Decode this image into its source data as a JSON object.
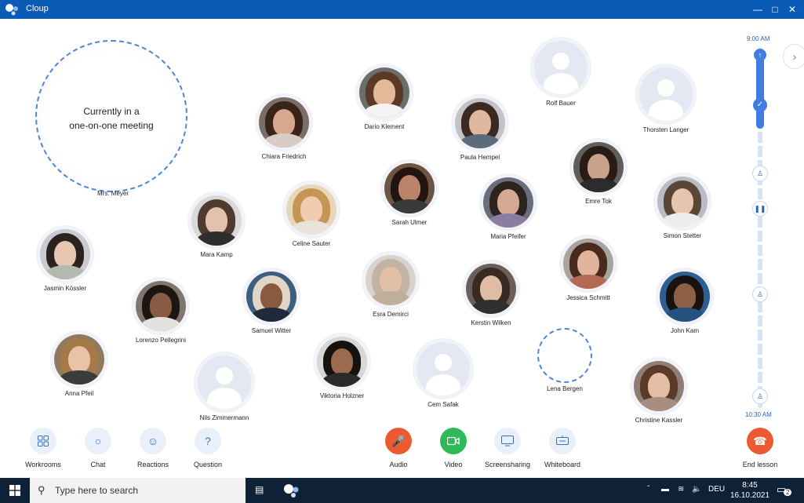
{
  "window": {
    "title": "Cloup"
  },
  "meeting": {
    "line1": "Currently in a",
    "line2": "one-on-one meeting",
    "person": "Mrs. Meyer"
  },
  "timeline": {
    "start": "9:00 AM",
    "end": "10:30 AM"
  },
  "participants": [
    {
      "name": "Dario Klement"
    },
    {
      "name": "Rolf Bauer"
    },
    {
      "name": "Thorsten Langer"
    },
    {
      "name": "Chiara Friedrich"
    },
    {
      "name": "Paula Hempel"
    },
    {
      "name": "Emre Tok"
    },
    {
      "name": "Sarah Ulmer"
    },
    {
      "name": "Celine Sauter"
    },
    {
      "name": "Mara Kamp"
    },
    {
      "name": "Maria Pfeifer"
    },
    {
      "name": "Simon Stetter"
    },
    {
      "name": "Jasmin Kössler"
    },
    {
      "name": "Jessica Schmitt"
    },
    {
      "name": "Esra Demirci"
    },
    {
      "name": "Kerstin Wilken"
    },
    {
      "name": "Lorenzo Pellegrini"
    },
    {
      "name": "Samuel Witter"
    },
    {
      "name": "John Kam"
    },
    {
      "name": "Anna Pfeil"
    },
    {
      "name": "Lena Bergen"
    },
    {
      "name": "Viktoria Holzner"
    },
    {
      "name": "Cem Safak"
    },
    {
      "name": "Nils Zimmermann"
    },
    {
      "name": "Christine Kassler"
    }
  ],
  "toolbar": {
    "workrooms": "Workrooms",
    "chat": "Chat",
    "reactions": "Reactions",
    "question": "Question",
    "audio": "Audio",
    "video": "Video",
    "screensharing": "Screensharing",
    "whiteboard": "Whiteboard",
    "end_lesson": "End lesson"
  },
  "taskbar": {
    "search_placeholder": "Type here to search",
    "language": "DEU",
    "time": "8:45",
    "date": "16.10.2021",
    "notifications": "2"
  },
  "colors": {
    "titlebar": "#0a5bb5",
    "accent": "#3f7ee0",
    "end": "#ec5a32",
    "video": "#2fba57"
  }
}
